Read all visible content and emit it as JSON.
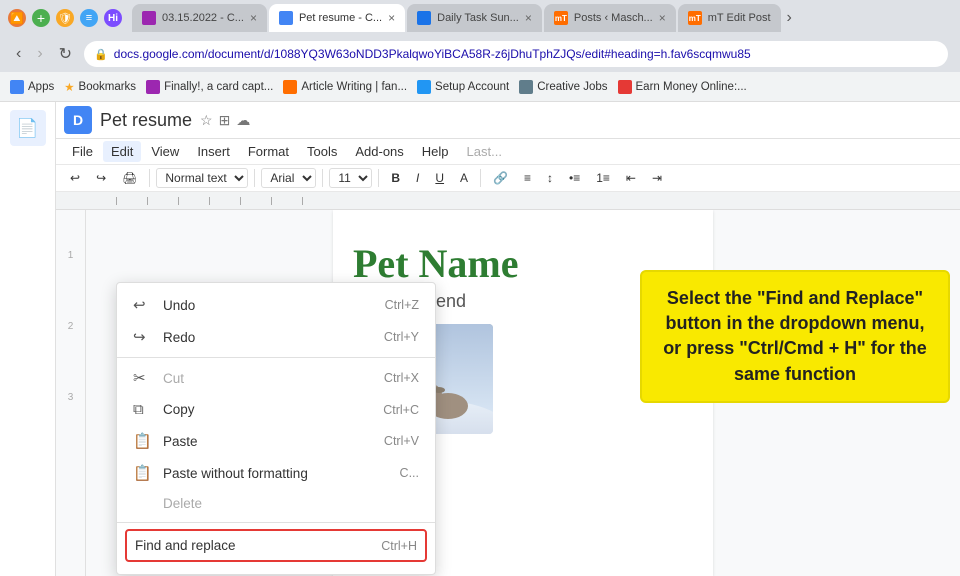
{
  "browser": {
    "tabs": [
      {
        "id": "tab1",
        "favicon_type": "up",
        "label": "UP",
        "title": "03.15.2022 - C...",
        "active": false
      },
      {
        "id": "tab2",
        "favicon_type": "gdoc",
        "title": "Pet resume - C...",
        "active": true
      },
      {
        "id": "tab3",
        "favicon_type": "tasks",
        "title": "Daily Task Sun...",
        "active": false
      },
      {
        "id": "tab4",
        "favicon_type": "mt",
        "title": "Posts ‹ Masch...",
        "active": false
      },
      {
        "id": "tab5",
        "favicon_type": "mt2",
        "title": "mT Edit Post",
        "active": false
      }
    ],
    "url": "docs.google.com/document/d/1088YQ3W63oNDD3PkalqwoYiBCA58R-z6jDhuTphZJQs/edit#heading=h.fav6scqmwu85",
    "nav": {
      "back": true,
      "forward": false,
      "reload": true
    }
  },
  "bookmarks": [
    {
      "id": "bm-apps",
      "label": "Apps",
      "type": "apps"
    },
    {
      "id": "bm-bookmarks",
      "label": "Bookmarks",
      "type": "star"
    },
    {
      "id": "bm-finally",
      "label": "Finally!, a card capt...",
      "type": "finally"
    },
    {
      "id": "bm-article",
      "label": "Article Writing | fan...",
      "type": "article"
    },
    {
      "id": "bm-setup",
      "label": "Setup Account",
      "type": "setup"
    },
    {
      "id": "bm-creative",
      "label": "Creative Jobs",
      "type": "creative"
    },
    {
      "id": "bm-earn",
      "label": "Earn Money Online:...",
      "type": "earn"
    }
  ],
  "doc": {
    "title": "Pet resume",
    "menu_items": [
      "File",
      "Edit",
      "View",
      "Insert",
      "Format",
      "Tools",
      "Add-ons",
      "Help",
      "Last..."
    ],
    "active_menu": "Edit",
    "format_label": "Format"
  },
  "dropdown": {
    "items": [
      {
        "id": "undo",
        "icon": "↩",
        "label": "Undo",
        "shortcut": "Ctrl+Z",
        "disabled": false
      },
      {
        "id": "redo",
        "icon": "↪",
        "label": "Redo",
        "shortcut": "Ctrl+Y",
        "disabled": false
      },
      {
        "id": "separator1",
        "type": "separator"
      },
      {
        "id": "cut",
        "icon": "✂",
        "label": "Cut",
        "shortcut": "Ctrl+X",
        "disabled": true
      },
      {
        "id": "copy",
        "icon": "⧉",
        "label": "Copy",
        "shortcut": "Ctrl+C",
        "disabled": false
      },
      {
        "id": "paste",
        "icon": "📋",
        "label": "Paste",
        "shortcut": "Ctrl+V",
        "disabled": false
      },
      {
        "id": "paste-no-format",
        "icon": "📋",
        "label": "Paste without formatting",
        "shortcut": "C...",
        "disabled": false
      },
      {
        "id": "delete",
        "icon": "",
        "label": "Delete",
        "shortcut": "",
        "disabled": false
      },
      {
        "id": "separator2",
        "type": "separator"
      },
      {
        "id": "find-replace",
        "icon": "",
        "label": "Find and replace",
        "shortcut": "Ctrl+H",
        "disabled": false,
        "highlighted": true
      }
    ]
  },
  "callout": {
    "text": "Select the \"Find and Replace\" button in the dropdown menu, or press \"Ctrl/Cmd + H\" for the same function"
  },
  "doc_content": {
    "pet_name": "Pet Name",
    "subtitle": "My best friend"
  },
  "format_toolbar": {
    "normal_text_label": "Normal text",
    "font_label": "Arial",
    "font_size": "11",
    "bold_label": "B",
    "italic_label": "I",
    "underline_label": "U",
    "color_label": "A"
  }
}
